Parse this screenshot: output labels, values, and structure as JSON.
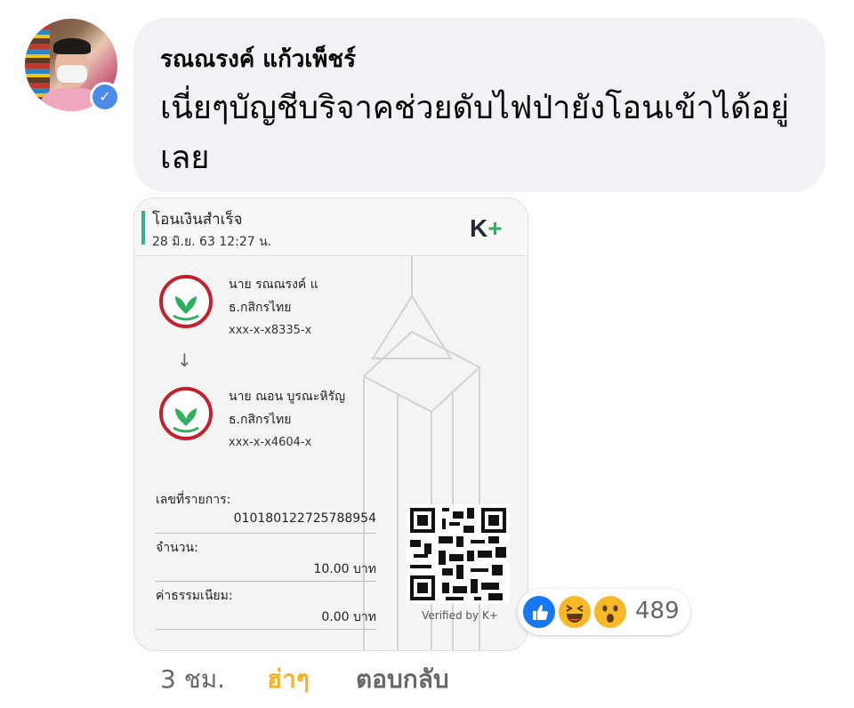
{
  "comment": {
    "author": "รณณรงค์ แก้วเพ็ชร์",
    "text": "เนี่ยๆบัญชีบริจาคช่วยดับไฟป่ายังโอนเข้าได้อยู่เลย"
  },
  "receipt": {
    "title": "โอนเงินสำเร็จ",
    "datetime": "28 มิ.ย. 63  12:27 น.",
    "brand_k": "K",
    "brand_plus": "+",
    "from": {
      "name": "นาย รณณรงค์ แ",
      "bank": "ธ.กสิกรไทย",
      "account": "xxx-x-x8335-x"
    },
    "to": {
      "name": "นาย ณอน บูรณะหิรัญ",
      "bank": "ธ.กสิกรไทย",
      "account": "xxx-x-x4604-x"
    },
    "arrow": "↓",
    "ref_label": "เลขที่รายการ:",
    "ref_value": "010180122725788954",
    "amount_label": "จำนวน:",
    "amount_value": "10.00 บาท",
    "fee_label": "ค่าธรรมเนียม:",
    "fee_value": "0.00 บาท",
    "verified_by": "Verified by K+",
    "colors": {
      "accent": "#2eb38a",
      "kbank_red": "#c4202b",
      "kbank_green": "#2fb05f"
    }
  },
  "reactions": {
    "icons": [
      "like-icon",
      "haha-icon",
      "wow-icon"
    ],
    "count": "489"
  },
  "meta": {
    "time": "3 ชม.",
    "reaction_link": "ฮ่าๆ",
    "reply_link": "ตอบกลับ"
  }
}
